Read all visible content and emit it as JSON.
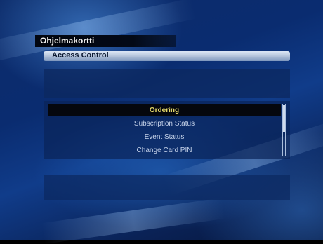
{
  "window": {
    "title": "Ohjelmakortti"
  },
  "header": {
    "title": "Access Control"
  },
  "menu": {
    "items": [
      {
        "label": "Ordering",
        "selected": true
      },
      {
        "label": "Subscription Status",
        "selected": false
      },
      {
        "label": "Event Status",
        "selected": false
      },
      {
        "label": "Change Card PIN",
        "selected": false
      }
    ]
  },
  "colors": {
    "background": "#0a2c70",
    "selected_text": "#e7da6a",
    "item_text": "#c6d3ea",
    "header_bar": "#b9c8de"
  }
}
